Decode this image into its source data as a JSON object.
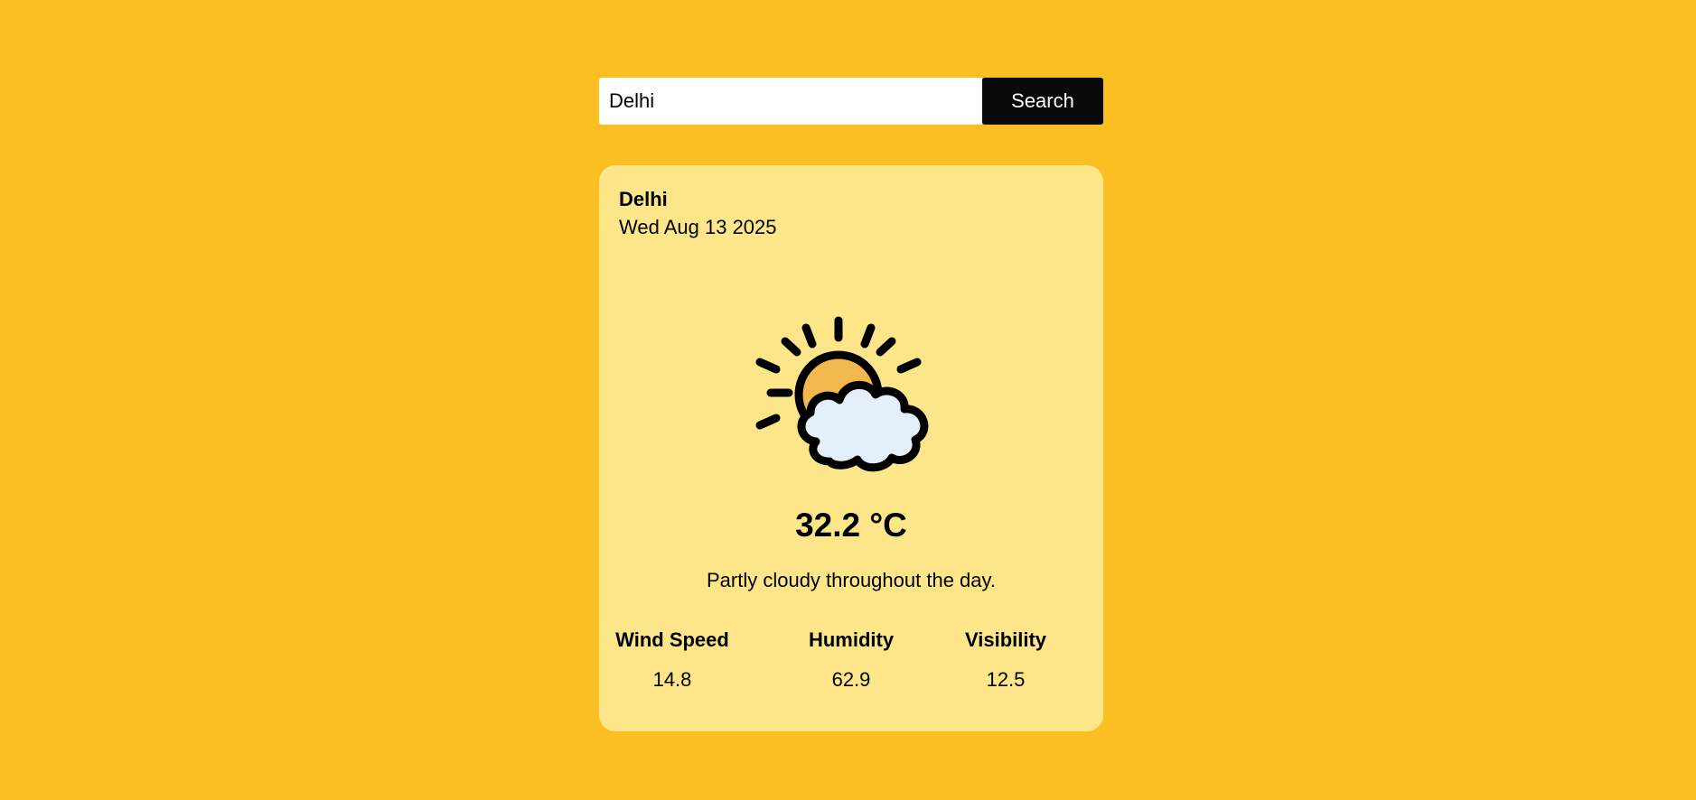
{
  "search": {
    "value": "Delhi",
    "button_label": "Search"
  },
  "card": {
    "city": "Delhi",
    "date": "Wed Aug 13 2025",
    "icon": "partly-cloudy-icon",
    "temperature": "32.2 °C",
    "description": "Partly cloudy throughout the day.",
    "stats": [
      {
        "label": "Wind Speed",
        "value": "14.8"
      },
      {
        "label": "Humidity",
        "value": "62.9"
      },
      {
        "label": "Visibility",
        "value": "12.5"
      }
    ]
  },
  "colors": {
    "background": "#fbbf24",
    "card": "#fde68a",
    "button": "#0a0a0a",
    "sun": "#f2b84b",
    "cloud": "#e3f0fb"
  }
}
